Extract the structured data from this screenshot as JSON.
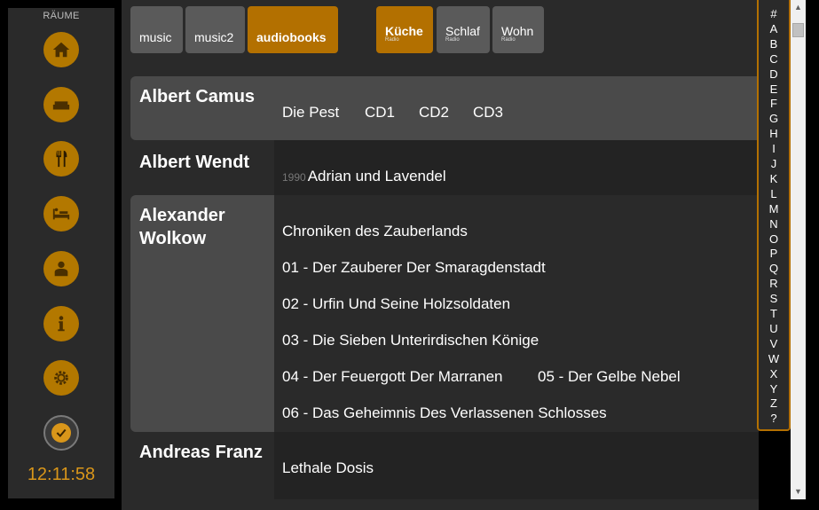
{
  "sidebar": {
    "title": "RÄUME",
    "rooms": [
      {
        "icon": "home-icon"
      },
      {
        "icon": "sofa-icon"
      },
      {
        "icon": "dining-icon"
      },
      {
        "icon": "bed-icon"
      },
      {
        "icon": "person-icon"
      },
      {
        "icon": "info-icon"
      },
      {
        "icon": "gear-icon"
      },
      {
        "icon": "check-icon"
      }
    ],
    "clock": "12:11:58"
  },
  "sources": [
    {
      "label": "music",
      "active": false
    },
    {
      "label": "music2",
      "active": false
    },
    {
      "label": "audiobooks",
      "active": true
    }
  ],
  "zones": [
    {
      "label": "Küche",
      "sub": "Radio",
      "active": true
    },
    {
      "label": "Schlaf",
      "sub": "Radio",
      "active": false
    },
    {
      "label": "Wohn",
      "sub": "Radio",
      "active": false
    }
  ],
  "artists": [
    {
      "name": "Albert Camus",
      "albums": [
        "Die Pest",
        "CD1",
        "CD2",
        "CD3"
      ]
    },
    {
      "name": "Albert Wendt",
      "year": "1990",
      "albums": [
        "Adrian und Lavendel"
      ]
    },
    {
      "name": "Alexander Wolkow",
      "albums": [
        "Chroniken des Zauberlands",
        "01 - Der Zauberer Der Smaragdenstadt",
        "02 - Urfin Und Seine Holzsoldaten",
        "03 - Die Sieben Unterirdischen Könige",
        "04 - Der Feuergott Der Marranen",
        "05 - Der Gelbe Nebel",
        "06 - Das Geheimnis Des Verlassenen Schlosses"
      ]
    },
    {
      "name": "Andreas Franz",
      "albums": [
        "Lethale Dosis"
      ]
    }
  ],
  "alphabet": [
    "#",
    "A",
    "B",
    "C",
    "D",
    "E",
    "F",
    "G",
    "H",
    "I",
    "J",
    "K",
    "L",
    "M",
    "N",
    "O",
    "P",
    "Q",
    "R",
    "S",
    "T",
    "U",
    "V",
    "W",
    "X",
    "Y",
    "Z",
    "?"
  ],
  "colors": {
    "accent": "#b37000",
    "panel": "#2a2a2a",
    "shaded": "#4a4a4a",
    "clock": "#d9961a"
  }
}
